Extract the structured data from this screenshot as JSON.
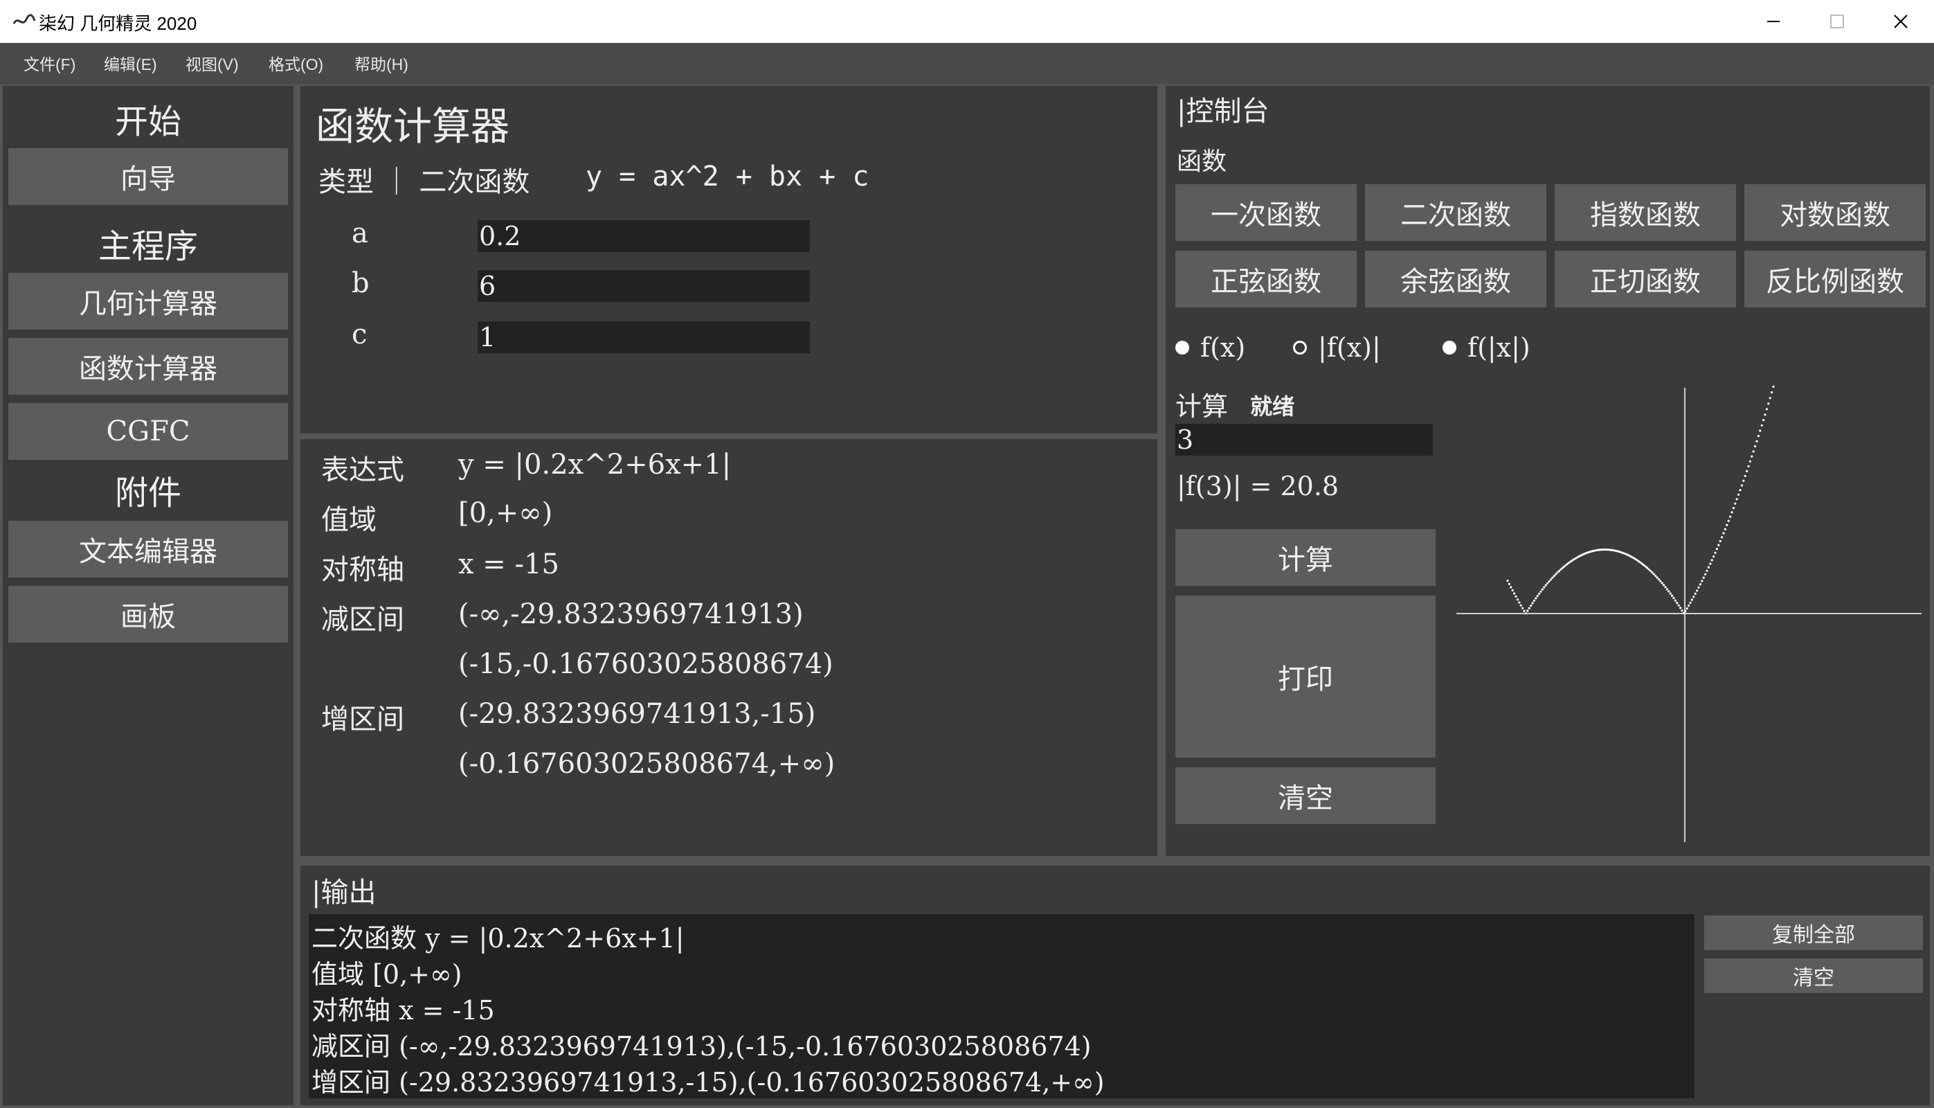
{
  "window": {
    "title": "柒幻 几何精灵 2020",
    "controls": {
      "minimize": "—",
      "maximize": "☐",
      "close": "✕"
    }
  },
  "menu": [
    "文件(F)",
    "编辑(E)",
    "视图(V)",
    "格式(O)",
    "帮助(H)"
  ],
  "sidebar": {
    "section_start": "开始",
    "btn_wizard": "向导",
    "section_main": "主程序",
    "btn_geometry": "几何计算器",
    "btn_function": "函数计算器",
    "btn_cgfc": "CGFC",
    "section_addons": "附件",
    "btn_text_editor": "文本编辑器",
    "btn_canvas": "画板"
  },
  "calculator": {
    "title": "函数计算器",
    "type_label": "类型 ｜ 二次函数",
    "formula": "y = ax^2 + bx + c",
    "params": [
      {
        "name": "a",
        "value": "0.2"
      },
      {
        "name": "b",
        "value": "6"
      },
      {
        "name": "c",
        "value": "1"
      }
    ]
  },
  "result": {
    "expr_label": "表达式",
    "expr": "y = |0.2x^2+6x+1|",
    "range_label": "值域",
    "range": "[0,+∞)",
    "axis_label": "对称轴",
    "axis": "x = -15",
    "dec_label": "减区间",
    "dec1": "(-∞,-29.8323969741913)",
    "dec2": "(-15,-0.167603025808674)",
    "inc_label": "增区间",
    "inc1": "(-29.8323969741913,-15)",
    "inc2": "(-0.167603025808674,+∞)"
  },
  "console": {
    "title": "|控制台",
    "func_label": "函数",
    "functions": [
      "一次函数",
      "二次函数",
      "指数函数",
      "对数函数",
      "正弦函数",
      "余弦函数",
      "正切函数",
      "反比例函数"
    ],
    "modes": [
      {
        "label": "f(x)",
        "selected": true
      },
      {
        "label": "|f(x)|",
        "selected": false
      },
      {
        "label": "f(|x|)",
        "selected": true
      }
    ],
    "compute_label": "计算",
    "status": "就绪",
    "x_value": "3",
    "result_text": "|f(3)| = 20.8",
    "btn_compute": "计算",
    "btn_print": "打印",
    "btn_clear": "清空",
    "graph": {
      "a": 0.2,
      "b": 6,
      "c": 1,
      "mode": "abs",
      "color": "#ffffff"
    }
  },
  "output": {
    "title": "|输出",
    "lines": [
      "二次函数  y = |0.2x^2+6x+1|",
      "  值域  [0,+∞)",
      "  对称轴  x = -15",
      "  减区间  (-∞,-29.8323969741913),(-15,-0.167603025808674)",
      "  增区间  (-29.8323969741913,-15),(-0.167603025808674,+∞)"
    ],
    "btn_copy_all": "复制全部",
    "btn_clear": "清空"
  },
  "colors": {
    "bg": "#565656",
    "panel": "#3a3a3a",
    "button": "#5c5c5c",
    "field": "#222222",
    "menu": "#4a4a4a"
  }
}
